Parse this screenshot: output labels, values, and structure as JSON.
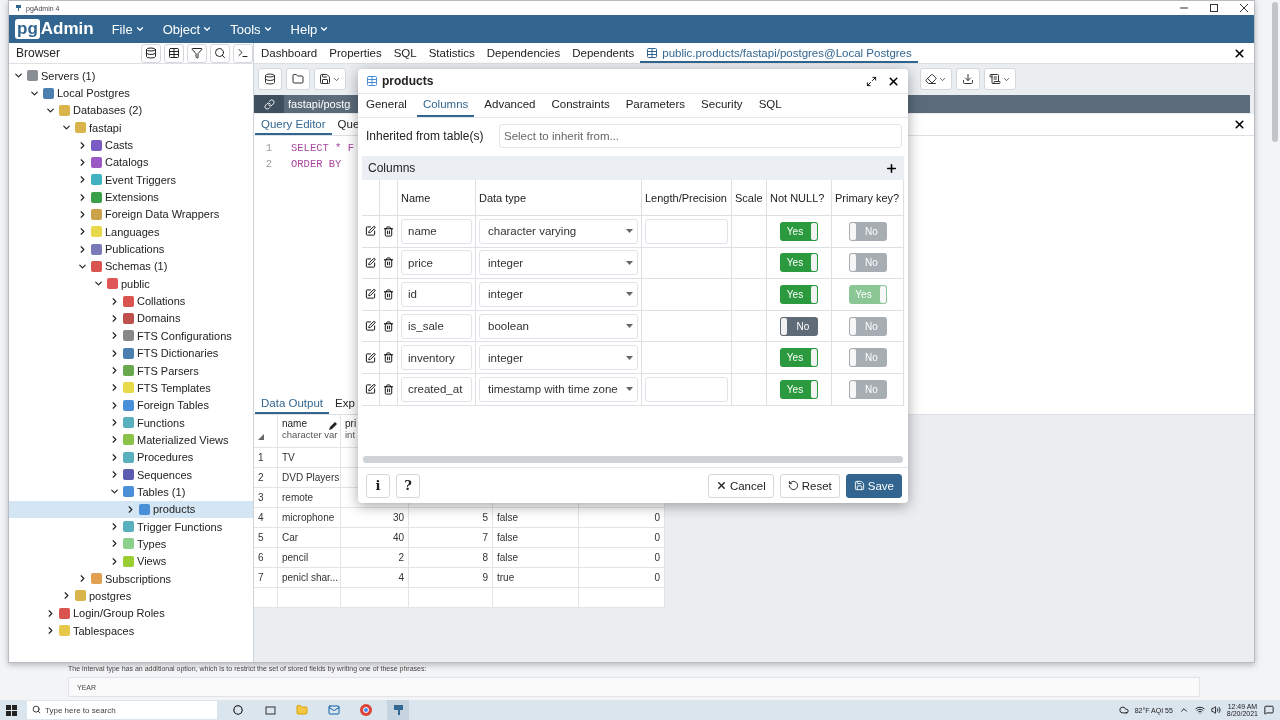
{
  "os_window": {
    "title": "pgAdmin 4"
  },
  "menu": {
    "logo_box": "pg",
    "logo_text": "Admin",
    "items": [
      "File",
      "Object",
      "Tools",
      "Help"
    ]
  },
  "browser": {
    "title": "Browser",
    "tree": [
      {
        "label": "Servers (1)",
        "expanded": true,
        "selected": false,
        "color": "#8a8f96",
        "children": [
          {
            "label": "Local Postgres",
            "expanded": true,
            "selected": false,
            "color": "#4a7fb0",
            "children": [
              {
                "label": "Databases (2)",
                "expanded": true,
                "selected": false,
                "color": "#d9b44a",
                "children": [
                  {
                    "label": "fastapi",
                    "expanded": true,
                    "selected": false,
                    "color": "#d9b44a",
                    "children": [
                      {
                        "label": "Casts",
                        "expanded": false,
                        "selected": false,
                        "color": "#7b5bc4"
                      },
                      {
                        "label": "Catalogs",
                        "expanded": false,
                        "selected": false,
                        "color": "#9b59c6"
                      },
                      {
                        "label": "Event Triggers",
                        "expanded": false,
                        "selected": false,
                        "color": "#3fb2c2"
                      },
                      {
                        "label": "Extensions",
                        "expanded": false,
                        "selected": false,
                        "color": "#3aa04a"
                      },
                      {
                        "label": "Foreign Data Wrappers",
                        "expanded": false,
                        "selected": false,
                        "color": "#c9a24a"
                      },
                      {
                        "label": "Languages",
                        "expanded": false,
                        "selected": false,
                        "color": "#e8d94a"
                      },
                      {
                        "label": "Publications",
                        "expanded": false,
                        "selected": false,
                        "color": "#7a7ab8"
                      },
                      {
                        "label": "Schemas (1)",
                        "expanded": true,
                        "selected": false,
                        "color": "#d9534f",
                        "children": [
                          {
                            "label": "public",
                            "expanded": true,
                            "selected": false,
                            "color": "#e05555",
                            "children": [
                              {
                                "label": "Collations",
                                "expanded": false,
                                "selected": false,
                                "color": "#d9534f"
                              },
                              {
                                "label": "Domains",
                                "expanded": false,
                                "selected": false,
                                "color": "#c0504d"
                              },
                              {
                                "label": "FTS Configurations",
                                "expanded": false,
                                "selected": false,
                                "color": "#888888"
                              },
                              {
                                "label": "FTS Dictionaries",
                                "expanded": false,
                                "selected": false,
                                "color": "#4a7fb0"
                              },
                              {
                                "label": "FTS Parsers",
                                "expanded": false,
                                "selected": false,
                                "color": "#6aa84f"
                              },
                              {
                                "label": "FTS Templates",
                                "expanded": false,
                                "selected": false,
                                "color": "#e8d94a"
                              },
                              {
                                "label": "Foreign Tables",
                                "expanded": false,
                                "selected": false,
                                "color": "#4a90d9"
                              },
                              {
                                "label": "Functions",
                                "expanded": false,
                                "selected": false,
                                "color": "#5bb0c0"
                              },
                              {
                                "label": "Materialized Views",
                                "expanded": false,
                                "selected": false,
                                "color": "#8bc34a"
                              },
                              {
                                "label": "Procedures",
                                "expanded": false,
                                "selected": false,
                                "color": "#5bb0c0"
                              },
                              {
                                "label": "Sequences",
                                "expanded": false,
                                "selected": false,
                                "color": "#5b5bb0"
                              },
                              {
                                "label": "Tables (1)",
                                "expanded": true,
                                "selected": false,
                                "color": "#4a90d9",
                                "children": [
                                  {
                                    "label": "products",
                                    "expanded": false,
                                    "selected": true,
                                    "color": "#4a90d9"
                                  }
                                ]
                              },
                              {
                                "label": "Trigger Functions",
                                "expanded": false,
                                "selected": false,
                                "color": "#5bb0c0"
                              },
                              {
                                "label": "Types",
                                "expanded": false,
                                "selected": false,
                                "color": "#8bd08b"
                              },
                              {
                                "label": "Views",
                                "expanded": false,
                                "selected": false,
                                "color": "#9acd32"
                              }
                            ]
                          }
                        ]
                      },
                      {
                        "label": "Subscriptions",
                        "expanded": false,
                        "selected": false,
                        "color": "#e0a050"
                      }
                    ]
                  },
                  {
                    "label": "postgres",
                    "expanded": false,
                    "selected": false,
                    "color": "#d9b44a"
                  }
                ]
              },
              {
                "label": "Login/Group Roles",
                "expanded": false,
                "selected": false,
                "color": "#d9534f"
              },
              {
                "label": "Tablespaces",
                "expanded": false,
                "selected": false,
                "color": "#e8c84a"
              }
            ]
          }
        ]
      }
    ]
  },
  "main_tabs": [
    {
      "label": "Dashboard",
      "selected": false,
      "kind": "plain"
    },
    {
      "label": "Properties",
      "selected": false,
      "kind": "plain"
    },
    {
      "label": "SQL",
      "selected": false,
      "kind": "plain"
    },
    {
      "label": "Statistics",
      "selected": false,
      "kind": "plain"
    },
    {
      "label": "Dependencies",
      "selected": false,
      "kind": "plain"
    },
    {
      "label": "Dependents",
      "selected": false,
      "kind": "plain"
    },
    {
      "label": "public.products/fastapi/postgres@Local Postgres",
      "selected": true,
      "kind": "table"
    }
  ],
  "query_tool": {
    "connection": "fastapi/postg",
    "tabs": [
      {
        "label": "Query Editor",
        "selected": true
      },
      {
        "label": "Que",
        "selected": false
      }
    ],
    "lines": [
      {
        "number": "1",
        "code": "SELECT * F"
      },
      {
        "number": "2",
        "code": "ORDER BY"
      }
    ]
  },
  "output": {
    "tabs": [
      {
        "label": "Data Output",
        "selected": true
      },
      {
        "label": "Exp",
        "selected": false
      }
    ],
    "columns": [
      {
        "name": "name",
        "type": "character var"
      },
      {
        "name": "pri",
        "type": "int"
      }
    ],
    "rows": [
      {
        "number": "1",
        "cells": [
          "TV"
        ]
      },
      {
        "number": "2",
        "cells": [
          "DVD Players"
        ]
      },
      {
        "number": "3",
        "cells": [
          "remote"
        ]
      },
      {
        "number": "4",
        "cells": [
          "microphone",
          "30",
          "5",
          "false",
          "0"
        ]
      },
      {
        "number": "5",
        "cells": [
          "Car",
          "40",
          "7",
          "false",
          "0"
        ]
      },
      {
        "number": "6",
        "cells": [
          "pencil",
          "2",
          "8",
          "false",
          "0"
        ]
      },
      {
        "number": "7",
        "cells": [
          "penicl shar...",
          "4",
          "9",
          "true",
          "0"
        ]
      }
    ]
  },
  "dialog": {
    "title": "products",
    "tabs": [
      {
        "label": "General",
        "selected": false
      },
      {
        "label": "Columns",
        "selected": true
      },
      {
        "label": "Advanced",
        "selected": false
      },
      {
        "label": "Constraints",
        "selected": false
      },
      {
        "label": "Parameters",
        "selected": false
      },
      {
        "label": "Security",
        "selected": false
      },
      {
        "label": "SQL",
        "selected": false
      }
    ],
    "inherit": {
      "label": "Inherited from table(s)",
      "placeholder": "Select to inherit from..."
    },
    "section": "Columns",
    "headers": [
      "Name",
      "Data type",
      "Length/Precision",
      "Scale",
      "Not NULL?",
      "Primary key?"
    ],
    "rows": [
      {
        "name": "name",
        "type": "character varying",
        "length_field": true,
        "not_null": {
          "label": "Yes",
          "on": true,
          "disabled": false
        },
        "primary_key": {
          "label": "No",
          "on": false,
          "disabled": true
        }
      },
      {
        "name": "price",
        "type": "integer",
        "length_field": false,
        "not_null": {
          "label": "Yes",
          "on": true,
          "disabled": false
        },
        "primary_key": {
          "label": "No",
          "on": false,
          "disabled": true
        }
      },
      {
        "name": "id",
        "type": "integer",
        "length_field": false,
        "not_null": {
          "label": "Yes",
          "on": true,
          "disabled": false
        },
        "primary_key": {
          "label": "Yes",
          "on": true,
          "disabled": true
        }
      },
      {
        "name": "is_sale",
        "type": "boolean",
        "length_field": false,
        "not_null": {
          "label": "No",
          "on": false,
          "disabled": false
        },
        "primary_key": {
          "label": "No",
          "on": false,
          "disabled": true
        }
      },
      {
        "name": "inventory",
        "type": "integer",
        "length_field": false,
        "not_null": {
          "label": "Yes",
          "on": true,
          "disabled": false
        },
        "primary_key": {
          "label": "No",
          "on": false,
          "disabled": true
        }
      },
      {
        "name": "created_at",
        "type": "timestamp with time zone",
        "length_field": true,
        "not_null": {
          "label": "Yes",
          "on": true,
          "disabled": false
        },
        "primary_key": {
          "label": "No",
          "on": false,
          "disabled": true
        }
      }
    ],
    "help_buttons": [
      "i",
      "?"
    ],
    "footer_buttons": [
      {
        "label": "Cancel",
        "kind": "cancel"
      },
      {
        "label": "Reset",
        "kind": "reset"
      },
      {
        "label": "Save",
        "kind": "save"
      }
    ]
  },
  "page_behind": {
    "text": "The interval type has an additional option, which is to restrict the set of stored fields by writing one of these phrases:",
    "box": "YEAR"
  },
  "taskbar": {
    "search_placeholder": "Type here to search",
    "weather": "82°F  AQI 55",
    "time": "12:49 AM",
    "date": "8/20/2021"
  }
}
